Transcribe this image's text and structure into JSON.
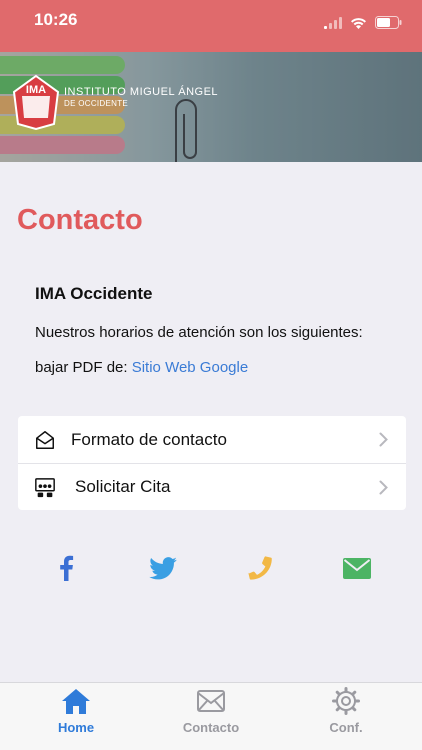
{
  "status_bar": {
    "time": "10:26"
  },
  "header": {
    "logo_text": "IMA",
    "institution_name": "INSTITUTO MIGUEL ÁNGEL",
    "institution_sub": "DE OCCIDENTE"
  },
  "page": {
    "title": "Contacto",
    "school_name": "IMA Occidente",
    "hours_text": "Nuestros horarios de atención son los siguientes:",
    "pdf_prefix": "bajar PDF de:",
    "pdf_link": "Sitio Web Google"
  },
  "menu": {
    "items": [
      {
        "label": "Formato de contacto",
        "icon": "envelope-open-icon"
      },
      {
        "label": "Solicitar Cita",
        "icon": "meeting-icon"
      }
    ]
  },
  "socials": [
    {
      "name": "facebook-icon",
      "color": "#3b6fd4"
    },
    {
      "name": "twitter-icon",
      "color": "#3a9fe3"
    },
    {
      "name": "phone-icon",
      "color": "#f2b845"
    },
    {
      "name": "mail-icon",
      "color": "#4cb464"
    }
  ],
  "tabbar": {
    "tabs": [
      {
        "label": "Home",
        "icon": "home-icon",
        "active": true
      },
      {
        "label": "Contacto",
        "icon": "envelope-icon",
        "active": false
      },
      {
        "label": "Conf.",
        "icon": "gear-icon",
        "active": false
      }
    ]
  },
  "colors": {
    "brand_red": "#e06a6c",
    "title_red": "#e05a5c",
    "link_blue": "#3a7bd5",
    "tab_active": "#2f7bd9"
  }
}
